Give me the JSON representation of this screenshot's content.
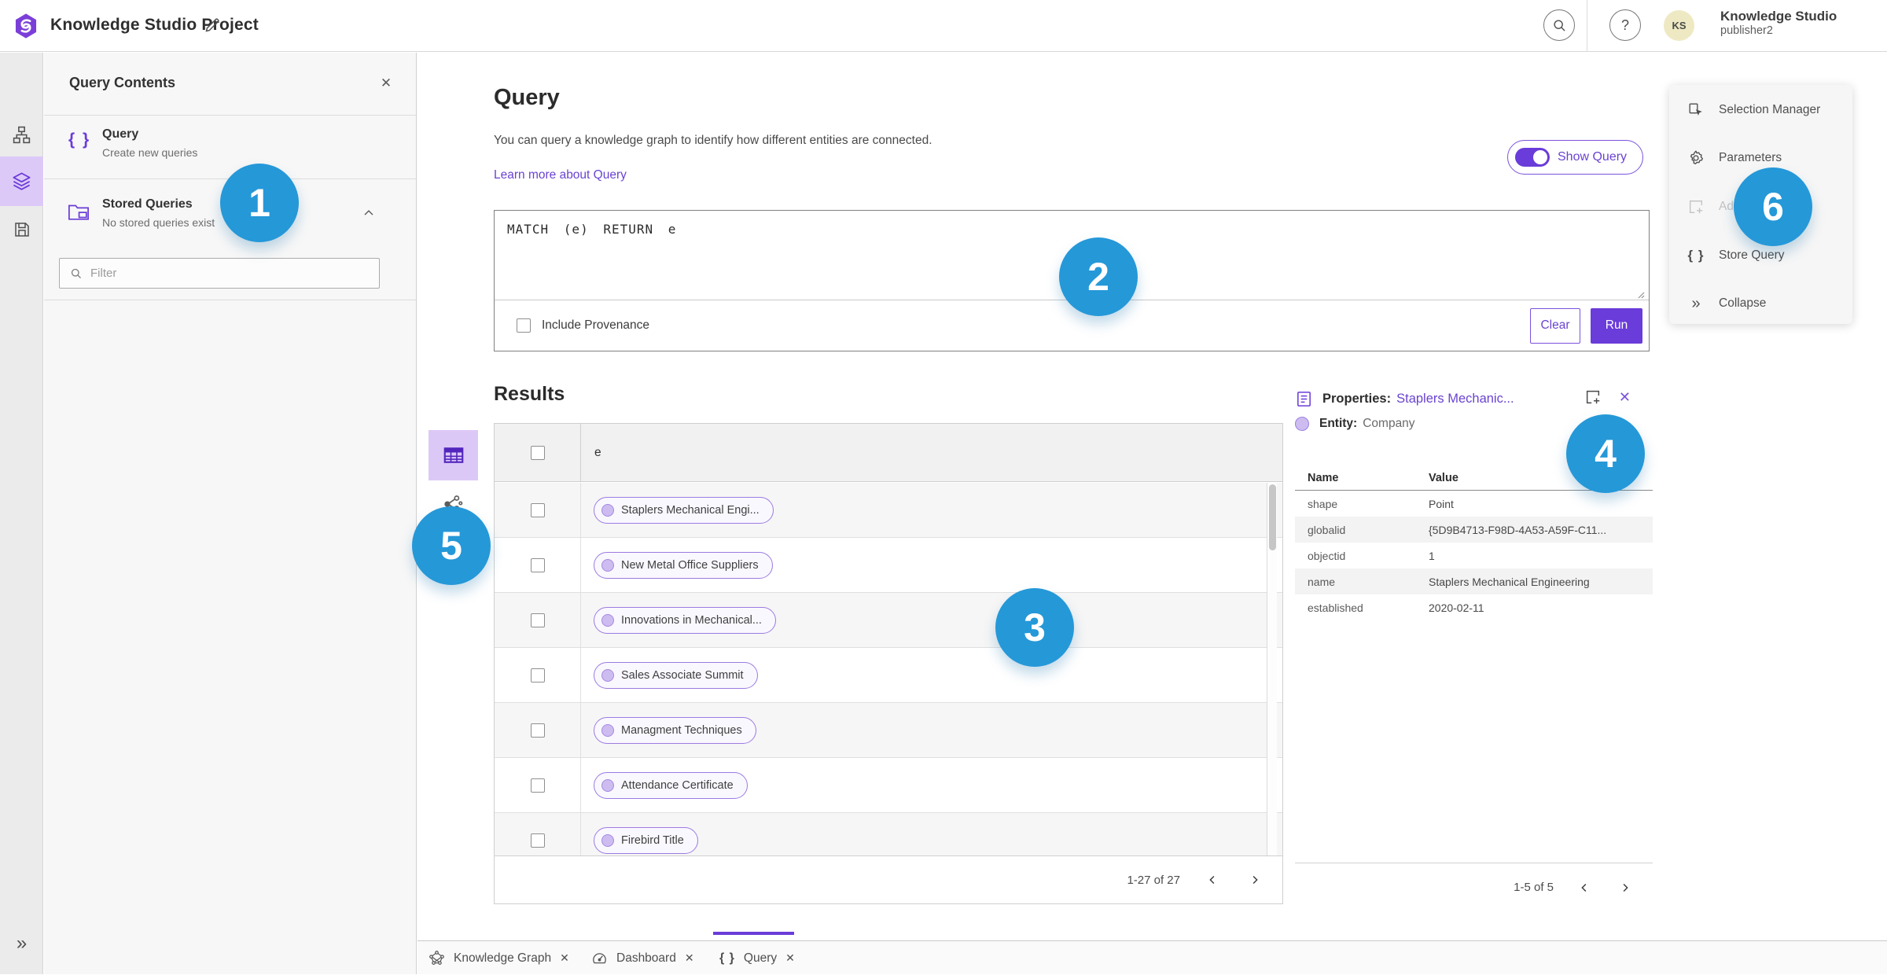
{
  "topbar": {
    "title": "Knowledge Studio Project",
    "user_name": "Knowledge Studio",
    "user_role": "publisher2",
    "avatar_initials": "KS",
    "help_glyph": "?"
  },
  "contents_panel": {
    "title": "Query Contents",
    "close_glyph": "✕",
    "query_item": {
      "title": "Query",
      "subtitle": "Create new queries",
      "icon_glyph": "{ }"
    },
    "stored_item": {
      "title": "Stored Queries",
      "subtitle": "No stored queries exist"
    },
    "filter_placeholder": "Filter"
  },
  "query_panel": {
    "title": "Query",
    "description": "You can query a knowledge graph to identify how different entities are connected.",
    "learn_more": "Learn more about Query",
    "show_query_label": "Show Query",
    "query_text": "MATCH (e) RETURN e",
    "include_provenance_label": "Include Provenance",
    "clear_label": "Clear",
    "run_label": "Run"
  },
  "results": {
    "title": "Results",
    "column_header": "e",
    "rows": [
      {
        "label": "Staplers Mechanical Engi..."
      },
      {
        "label": "New Metal Office Suppliers"
      },
      {
        "label": "Innovations in Mechanical..."
      },
      {
        "label": "Sales Associate Summit"
      },
      {
        "label": "Managment Techniques"
      },
      {
        "label": "Attendance Certificate"
      },
      {
        "label": "Firebird Title"
      }
    ],
    "pagination": "1-27 of 27"
  },
  "properties": {
    "title": "Properties:",
    "entity_link": "Staplers Mechanic...",
    "entity_label": "Entity:",
    "entity_type": "Company",
    "name_header": "Name",
    "value_header": "Value",
    "close_glyph": "✕",
    "rows": [
      {
        "name": "shape",
        "value": "Point"
      },
      {
        "name": "globalid",
        "value": "{5D9B4713-F98D-4A53-A59F-C11..."
      },
      {
        "name": "objectid",
        "value": "1"
      },
      {
        "name": "name",
        "value": "Staplers Mechanical Engineering"
      },
      {
        "name": "established",
        "value": "2020-02-11"
      }
    ],
    "pagination": "1-5 of 5"
  },
  "action_menu": {
    "items": [
      {
        "label": "Selection Manager"
      },
      {
        "label": "Parameters"
      },
      {
        "label": "Ad"
      },
      {
        "label": "Store Query",
        "icon_glyph": "{ }"
      },
      {
        "label": "Collapse",
        "icon_glyph": "»"
      }
    ]
  },
  "tabs": [
    {
      "label": "Knowledge Graph",
      "close_glyph": "✕"
    },
    {
      "label": "Dashboard",
      "close_glyph": "✕"
    },
    {
      "label": "Query",
      "close_glyph": "✕",
      "icon_glyph": "{ }"
    }
  ],
  "rail": {
    "expand_glyph": "»"
  },
  "badges": {
    "b1": "1",
    "b2": "2",
    "b3": "3",
    "b4": "4",
    "b5": "5",
    "b6": "6"
  },
  "colors": {
    "accent_purple": "#6a3cd9",
    "badge_blue": "#2598d8",
    "selection_lavender": "#ddc9f8"
  }
}
